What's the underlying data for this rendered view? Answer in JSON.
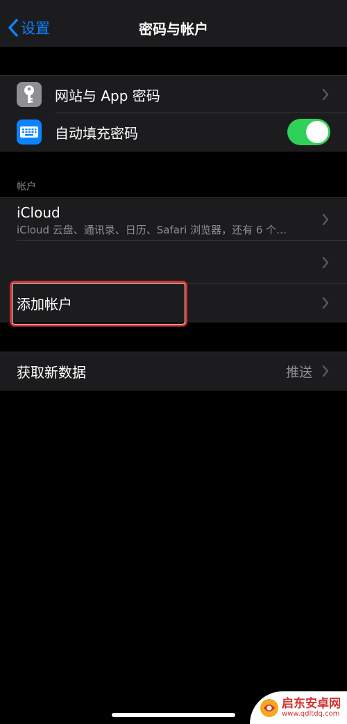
{
  "nav": {
    "back_label": "设置",
    "title": "密码与帐户"
  },
  "passwords": {
    "items": [
      {
        "label": "网站与 App 密码",
        "icon": "key-icon"
      },
      {
        "label": "自动填充密码",
        "icon": "keyboard-icon",
        "toggle_on": true
      }
    ]
  },
  "accounts": {
    "header": "帐户",
    "icloud": {
      "title": "iCloud",
      "subtitle": "iCloud 云盘、通讯录、日历、Safari 浏览器，还有 6 个…"
    },
    "empty_row_label": "",
    "add_account": "添加帐户"
  },
  "fetch": {
    "label": "获取新数据",
    "value": "推送"
  },
  "watermark": {
    "title": "启东安卓网",
    "url": "www.qdltdq.com"
  },
  "colors": {
    "accent": "#0a84ff",
    "toggle": "#30d158",
    "highlight": "#d32f2f"
  }
}
